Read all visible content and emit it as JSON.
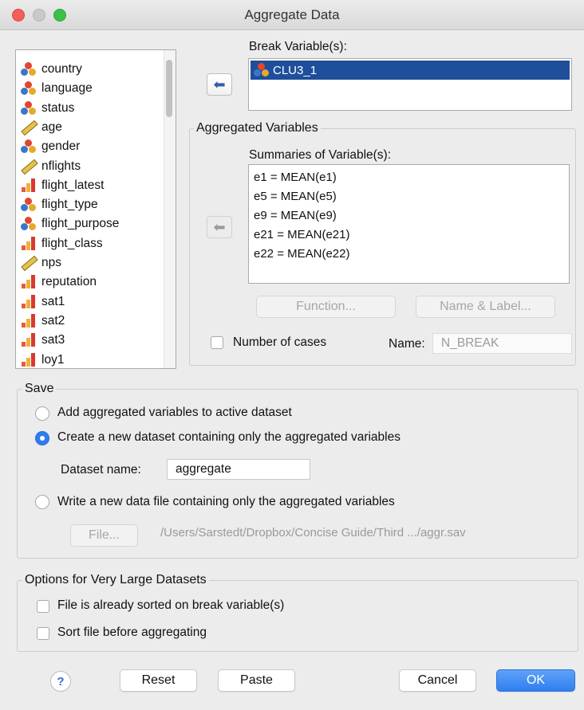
{
  "window": {
    "title": "Aggregate Data"
  },
  "variables": [
    {
      "name": "country",
      "icon": "nominal-icon"
    },
    {
      "name": "language",
      "icon": "nominal-icon"
    },
    {
      "name": "status",
      "icon": "nominal-icon"
    },
    {
      "name": "age",
      "icon": "scale-icon"
    },
    {
      "name": "gender",
      "icon": "nominal-icon"
    },
    {
      "name": "nflights",
      "icon": "scale-icon"
    },
    {
      "name": "flight_latest",
      "icon": "ordinal-icon"
    },
    {
      "name": "flight_type",
      "icon": "nominal-icon"
    },
    {
      "name": "flight_purpose",
      "icon": "nominal-icon"
    },
    {
      "name": "flight_class",
      "icon": "ordinal-icon"
    },
    {
      "name": "nps",
      "icon": "scale-icon"
    },
    {
      "name": "reputation",
      "icon": "ordinal-icon"
    },
    {
      "name": "sat1",
      "icon": "ordinal-icon"
    },
    {
      "name": "sat2",
      "icon": "ordinal-icon"
    },
    {
      "name": "sat3",
      "icon": "ordinal-icon"
    },
    {
      "name": "loy1",
      "icon": "ordinal-icon"
    }
  ],
  "break": {
    "label": "Break Variable(s):",
    "items": [
      {
        "name": "CLU3_1",
        "icon": "nominal-icon"
      }
    ]
  },
  "aggregated": {
    "group_title": "Aggregated Variables",
    "summaries_label": "Summaries of Variable(s):",
    "items": [
      "e1 = MEAN(e1)",
      "e5 = MEAN(e5)",
      "e9 = MEAN(e9)",
      "e21 = MEAN(e21)",
      "e22 = MEAN(e22)"
    ],
    "function_button": "Function...",
    "name_label_button": "Name & Label...",
    "number_of_cases_label": "Number of cases",
    "name_label": "Name:",
    "name_value": "N_BREAK"
  },
  "save": {
    "group_title": "Save",
    "option_add": "Add aggregated variables to active dataset",
    "option_create": "Create a new dataset containing only the aggregated variables",
    "dataset_name_label": "Dataset name:",
    "dataset_name_value": "aggregate",
    "option_write": "Write a new data file containing only the aggregated variables",
    "file_button": "File...",
    "file_path": "/Users/Sarstedt/Dropbox/Concise Guide/Third .../aggr.sav",
    "selected": "create"
  },
  "options": {
    "group_title": "Options for Very Large Datasets",
    "sorted_label": "File is already sorted on break variable(s)",
    "sort_before_label": "Sort file before aggregating"
  },
  "footer": {
    "help": "?",
    "reset": "Reset",
    "paste": "Paste",
    "cancel": "Cancel",
    "ok": "OK"
  },
  "colors": {
    "selection": "#1f4e9b",
    "primary_button": "#2f7ff0"
  }
}
